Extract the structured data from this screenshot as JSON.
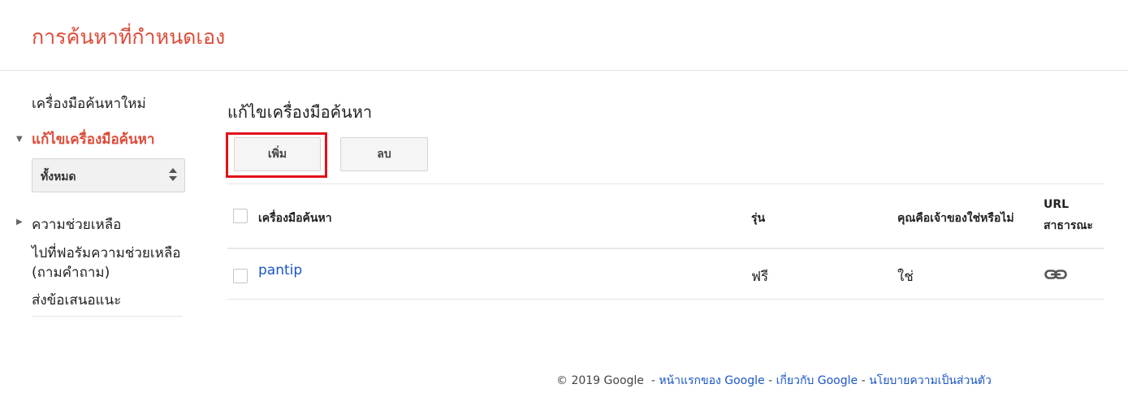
{
  "header": {
    "title": "การค้นหาที่กำหนดเอง"
  },
  "sidebar": {
    "new_engine": "เครื่องมือค้นหาใหม่",
    "edit_engine": "แก้ไขเครื่องมือค้นหา",
    "select_value": "ทั้งหมด",
    "help": "ความช่วยเหลือ",
    "forum_line1": "ไปที่ฟอรัมความช่วยเหลือ",
    "forum_line2": "(ถามคำถาม)",
    "feedback": "ส่งข้อเสนอแนะ"
  },
  "main": {
    "title": "แก้ไขเครื่องมือค้นหา",
    "add_button": "เพิ่ม",
    "delete_button": "ลบ",
    "columns": {
      "name": "เครื่องมือค้นหา",
      "edition": "รุ่น",
      "owner": "คุณคือเจ้าของใช่หรือไม่",
      "public_url_line1": "URL",
      "public_url_line2": "สาธารณะ"
    },
    "rows": [
      {
        "name": "pantip",
        "edition": "ฟรี",
        "owner": "ใช่",
        "url_icon": "link-icon"
      }
    ]
  },
  "footer": {
    "copyright": "© 2019 Google",
    "sep": "-",
    "link_home": "หน้าแรกของ Google",
    "link_about": "เกี่ยวกับ Google",
    "link_privacy": "นโยบายความเป็นส่วนตัว"
  },
  "colors": {
    "accent": "#dd4b39",
    "link": "#1a55c8",
    "highlight": "#e0121a"
  }
}
